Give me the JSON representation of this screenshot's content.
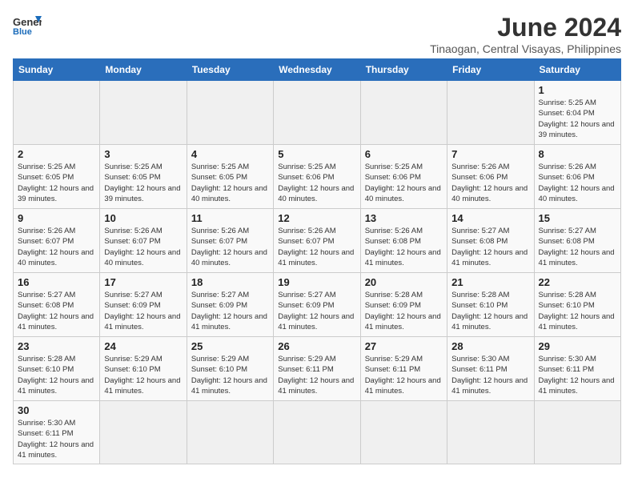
{
  "header": {
    "logo_general": "General",
    "logo_blue": "Blue",
    "title": "June 2024",
    "subtitle": "Tinaogan, Central Visayas, Philippines"
  },
  "weekdays": [
    "Sunday",
    "Monday",
    "Tuesday",
    "Wednesday",
    "Thursday",
    "Friday",
    "Saturday"
  ],
  "weeks": [
    [
      {
        "day": "",
        "empty": true
      },
      {
        "day": "",
        "empty": true
      },
      {
        "day": "",
        "empty": true
      },
      {
        "day": "",
        "empty": true
      },
      {
        "day": "",
        "empty": true
      },
      {
        "day": "",
        "empty": true
      },
      {
        "day": "1",
        "info": "Sunrise: 5:25 AM\nSunset: 6:04 PM\nDaylight: 12 hours\nand 39 minutes."
      }
    ],
    [
      {
        "day": "2",
        "info": "Sunrise: 5:25 AM\nSunset: 6:05 PM\nDaylight: 12 hours\nand 39 minutes."
      },
      {
        "day": "3",
        "info": "Sunrise: 5:25 AM\nSunset: 6:05 PM\nDaylight: 12 hours\nand 39 minutes."
      },
      {
        "day": "4",
        "info": "Sunrise: 5:25 AM\nSunset: 6:05 PM\nDaylight: 12 hours\nand 40 minutes."
      },
      {
        "day": "5",
        "info": "Sunrise: 5:25 AM\nSunset: 6:06 PM\nDaylight: 12 hours\nand 40 minutes."
      },
      {
        "day": "6",
        "info": "Sunrise: 5:25 AM\nSunset: 6:06 PM\nDaylight: 12 hours\nand 40 minutes."
      },
      {
        "day": "7",
        "info": "Sunrise: 5:26 AM\nSunset: 6:06 PM\nDaylight: 12 hours\nand 40 minutes."
      },
      {
        "day": "8",
        "info": "Sunrise: 5:26 AM\nSunset: 6:06 PM\nDaylight: 12 hours\nand 40 minutes."
      }
    ],
    [
      {
        "day": "9",
        "info": "Sunrise: 5:26 AM\nSunset: 6:07 PM\nDaylight: 12 hours\nand 40 minutes."
      },
      {
        "day": "10",
        "info": "Sunrise: 5:26 AM\nSunset: 6:07 PM\nDaylight: 12 hours\nand 40 minutes."
      },
      {
        "day": "11",
        "info": "Sunrise: 5:26 AM\nSunset: 6:07 PM\nDaylight: 12 hours\nand 40 minutes."
      },
      {
        "day": "12",
        "info": "Sunrise: 5:26 AM\nSunset: 6:07 PM\nDaylight: 12 hours\nand 41 minutes."
      },
      {
        "day": "13",
        "info": "Sunrise: 5:26 AM\nSunset: 6:08 PM\nDaylight: 12 hours\nand 41 minutes."
      },
      {
        "day": "14",
        "info": "Sunrise: 5:27 AM\nSunset: 6:08 PM\nDaylight: 12 hours\nand 41 minutes."
      },
      {
        "day": "15",
        "info": "Sunrise: 5:27 AM\nSunset: 6:08 PM\nDaylight: 12 hours\nand 41 minutes."
      }
    ],
    [
      {
        "day": "16",
        "info": "Sunrise: 5:27 AM\nSunset: 6:08 PM\nDaylight: 12 hours\nand 41 minutes."
      },
      {
        "day": "17",
        "info": "Sunrise: 5:27 AM\nSunset: 6:09 PM\nDaylight: 12 hours\nand 41 minutes."
      },
      {
        "day": "18",
        "info": "Sunrise: 5:27 AM\nSunset: 6:09 PM\nDaylight: 12 hours\nand 41 minutes."
      },
      {
        "day": "19",
        "info": "Sunrise: 5:27 AM\nSunset: 6:09 PM\nDaylight: 12 hours\nand 41 minutes."
      },
      {
        "day": "20",
        "info": "Sunrise: 5:28 AM\nSunset: 6:09 PM\nDaylight: 12 hours\nand 41 minutes."
      },
      {
        "day": "21",
        "info": "Sunrise: 5:28 AM\nSunset: 6:10 PM\nDaylight: 12 hours\nand 41 minutes."
      },
      {
        "day": "22",
        "info": "Sunrise: 5:28 AM\nSunset: 6:10 PM\nDaylight: 12 hours\nand 41 minutes."
      }
    ],
    [
      {
        "day": "23",
        "info": "Sunrise: 5:28 AM\nSunset: 6:10 PM\nDaylight: 12 hours\nand 41 minutes."
      },
      {
        "day": "24",
        "info": "Sunrise: 5:29 AM\nSunset: 6:10 PM\nDaylight: 12 hours\nand 41 minutes."
      },
      {
        "day": "25",
        "info": "Sunrise: 5:29 AM\nSunset: 6:10 PM\nDaylight: 12 hours\nand 41 minutes."
      },
      {
        "day": "26",
        "info": "Sunrise: 5:29 AM\nSunset: 6:11 PM\nDaylight: 12 hours\nand 41 minutes."
      },
      {
        "day": "27",
        "info": "Sunrise: 5:29 AM\nSunset: 6:11 PM\nDaylight: 12 hours\nand 41 minutes."
      },
      {
        "day": "28",
        "info": "Sunrise: 5:30 AM\nSunset: 6:11 PM\nDaylight: 12 hours\nand 41 minutes."
      },
      {
        "day": "29",
        "info": "Sunrise: 5:30 AM\nSunset: 6:11 PM\nDaylight: 12 hours\nand 41 minutes."
      }
    ],
    [
      {
        "day": "30",
        "info": "Sunrise: 5:30 AM\nSunset: 6:11 PM\nDaylight: 12 hours\nand 41 minutes."
      },
      {
        "day": "",
        "empty": true
      },
      {
        "day": "",
        "empty": true
      },
      {
        "day": "",
        "empty": true
      },
      {
        "day": "",
        "empty": true
      },
      {
        "day": "",
        "empty": true
      },
      {
        "day": "",
        "empty": true
      }
    ]
  ]
}
